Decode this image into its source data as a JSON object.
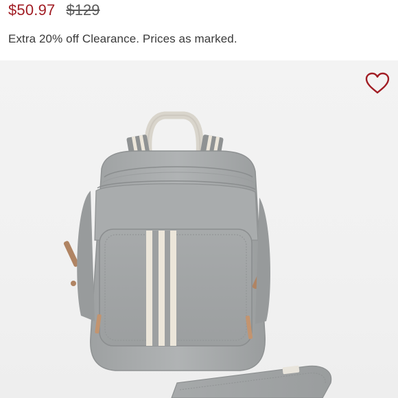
{
  "product": {
    "sale_price": "$50.97",
    "original_price": "$129",
    "promo_text": "Extra 20% off Clearance. Prices as marked."
  },
  "colors": {
    "sale_price": "#a11d24",
    "wishlist_heart": "#a11d24",
    "backpack_body": "#a9acad",
    "stripe": "#ece6da"
  },
  "icons": {
    "wishlist": "heart-icon"
  }
}
